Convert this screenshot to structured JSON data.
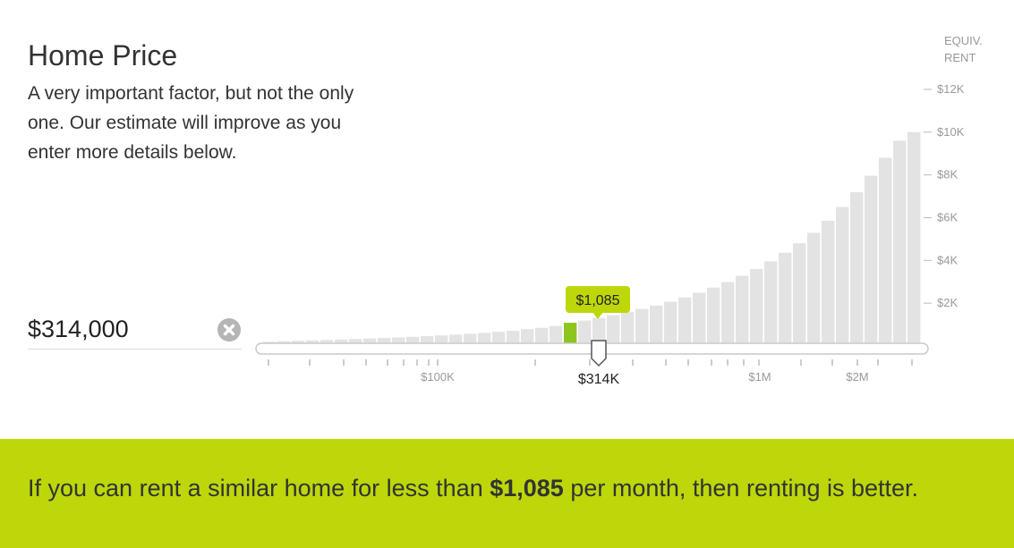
{
  "header": {
    "title": "Home Price",
    "description": "A very important factor, but not the only one. Our estimate will improve as you enter more details below."
  },
  "price_input": {
    "value": "$314,000",
    "clear_icon": "close-circle-icon"
  },
  "chart_data": {
    "type": "bar",
    "ylabel": "EQUIV. RENT",
    "y_ticks": [
      "$2K",
      "$4K",
      "$6K",
      "$8K",
      "$10K",
      "$12K"
    ],
    "y_tick_values": [
      2000,
      4000,
      6000,
      8000,
      10000,
      12000
    ],
    "ylim": [
      0,
      12000
    ],
    "x_tick_labels": [
      "$100K",
      "$1M",
      "$2M"
    ],
    "values": [
      200,
      220,
      240,
      260,
      280,
      300,
      325,
      350,
      375,
      400,
      430,
      460,
      495,
      530,
      570,
      610,
      660,
      710,
      790,
      850,
      935,
      1085,
      1190,
      1310,
      1440,
      1580,
      1730,
      1890,
      2070,
      2270,
      2490,
      2730,
      2990,
      3280,
      3600,
      3960,
      4360,
      4800,
      5290,
      5860,
      6500,
      7200,
      7960,
      8800,
      9600,
      10000
    ],
    "selected_index": 21,
    "selected_label": "$1,085",
    "slider_value_label": "$314K",
    "colors": {
      "bar": "#e3e3e3",
      "selected": "#8cc51e",
      "callout": "#bdd70a",
      "axis_text": "#999999"
    }
  },
  "banner": {
    "prefix": "If you can rent a similar home for less than ",
    "amount": "$1,085",
    "suffix": " per month, then renting is better.",
    "color": "#bdd70a"
  }
}
